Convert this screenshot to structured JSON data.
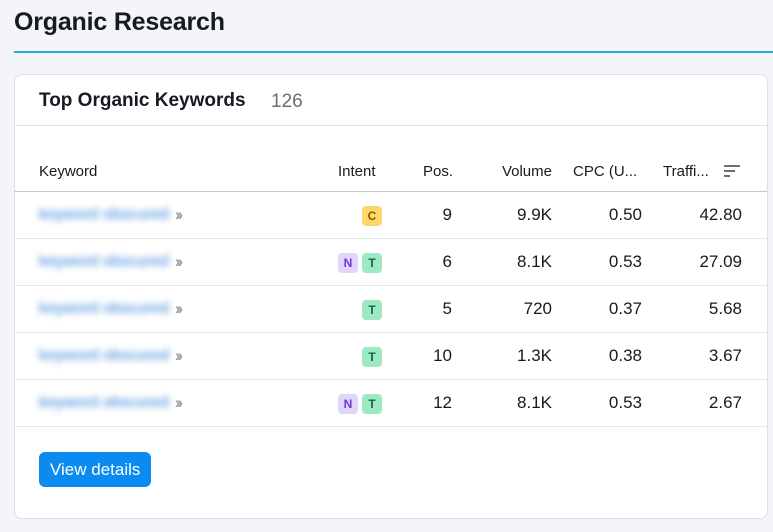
{
  "page": {
    "title": "Organic Research"
  },
  "card": {
    "title": "Top Organic Keywords",
    "count": "126"
  },
  "table": {
    "headers": {
      "keyword": "Keyword",
      "intent": "Intent",
      "pos": "Pos.",
      "volume": "Volume",
      "cpc": "CPC (U...",
      "traffic": "Traffi..."
    },
    "rows": [
      {
        "keyword": "keyword obscured",
        "intents": [
          "C"
        ],
        "pos": "9",
        "volume": "9.9K",
        "cpc": "0.50",
        "traffic": "42.80"
      },
      {
        "keyword": "keyword obscured",
        "intents": [
          "N",
          "T"
        ],
        "pos": "6",
        "volume": "8.1K",
        "cpc": "0.53",
        "traffic": "27.09"
      },
      {
        "keyword": "keyword obscured",
        "intents": [
          "T"
        ],
        "pos": "5",
        "volume": "720",
        "cpc": "0.37",
        "traffic": "5.68"
      },
      {
        "keyword": "keyword obscured",
        "intents": [
          "T"
        ],
        "pos": "10",
        "volume": "1.3K",
        "cpc": "0.38",
        "traffic": "3.67"
      },
      {
        "keyword": "keyword obscured",
        "intents": [
          "N",
          "T"
        ],
        "pos": "12",
        "volume": "8.1K",
        "cpc": "0.53",
        "traffic": "2.67"
      }
    ]
  },
  "actions": {
    "view_details": "View details"
  },
  "icons": {
    "sort": "sort-icon",
    "chevron": "double-chevron-right-icon"
  },
  "colors": {
    "accent": "#0b8bf0",
    "rule": "#2fa3e6",
    "link": "#0a67d0"
  }
}
